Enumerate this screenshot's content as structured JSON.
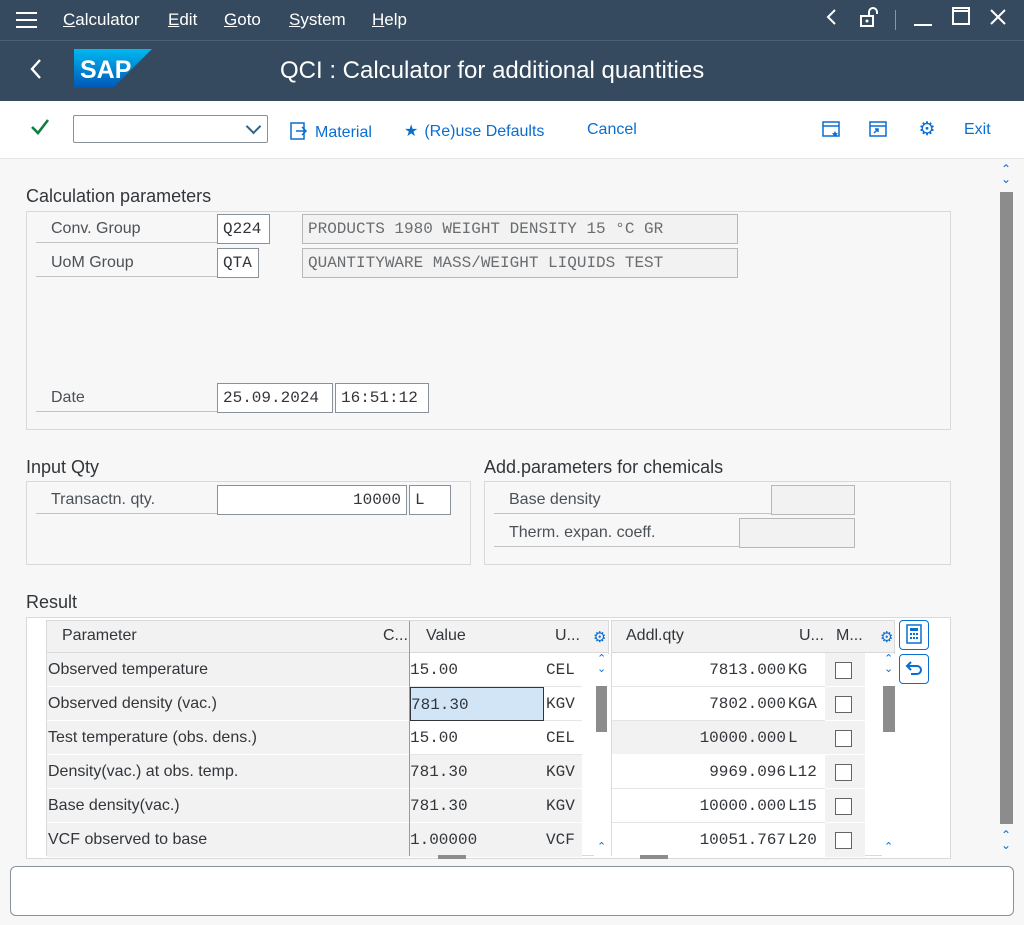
{
  "menu": {
    "items": [
      {
        "u": "C",
        "rest": "alculator"
      },
      {
        "u": "E",
        "rest": "dit"
      },
      {
        "u": "G",
        "rest": "oto"
      },
      {
        "u": "S",
        "rest": "ystem"
      },
      {
        "u": "H",
        "rest": "elp"
      }
    ]
  },
  "header": {
    "title": "QCI : Calculator for additional quantities",
    "logo_text": "SAP"
  },
  "toolbar": {
    "material_label": "Material",
    "reuse_label": "(Re)use Defaults",
    "cancel_label": "Cancel",
    "exit_label": "Exit",
    "combo_value": ""
  },
  "calc_params": {
    "title": "Calculation parameters",
    "conv_group_label": "Conv. Group",
    "conv_group_value": "Q224",
    "conv_group_desc": "PRODUCTS 1980 WEIGHT DENSITY 15 °C GR",
    "uom_group_label": "UoM Group",
    "uom_group_value": "QTA",
    "uom_group_desc": "QUANTITYWARE MASS/WEIGHT LIQUIDS TEST",
    "date_label": "Date",
    "date_value": "25.09.2024",
    "time_value": "16:51:12"
  },
  "input_qty": {
    "title": "Input Qty",
    "transactn_label": "Transactn. qty.",
    "transactn_value": "10000",
    "transactn_unit": "L"
  },
  "chem": {
    "title": "Add.parameters for chemicals",
    "base_density_label": "Base density",
    "therm_label": "Therm. expan. coeff."
  },
  "result": {
    "title": "Result",
    "headers": {
      "parameter": "Parameter",
      "c": "C...",
      "value": "Value",
      "u1": "U...",
      "addl": "Addl.qty",
      "u2": "U...",
      "m": "M..."
    },
    "rows": [
      {
        "parameter": "Observed temperature",
        "value": "15.00",
        "unit": "CEL"
      },
      {
        "parameter": "Observed density (vac.)",
        "value": "781.30",
        "unit": "KGV"
      },
      {
        "parameter": "Test temperature (obs. dens.)",
        "value": "15.00",
        "unit": "CEL"
      },
      {
        "parameter": "Density(vac.) at obs. temp.",
        "value": "781.30",
        "unit": "KGV"
      },
      {
        "parameter": "Base density(vac.)",
        "value": "781.30",
        "unit": "KGV"
      },
      {
        "parameter": "VCF observed to base",
        "value": "1.00000",
        "unit": "VCF"
      }
    ],
    "addl": [
      {
        "qty": "7813.000",
        "unit": "KG"
      },
      {
        "qty": "7802.000",
        "unit": "KGA"
      },
      {
        "qty": "10000.000",
        "unit": "L"
      },
      {
        "qty": "9969.096",
        "unit": "L12"
      },
      {
        "qty": "10000.000",
        "unit": "L15"
      },
      {
        "qty": "10051.767",
        "unit": "L20"
      }
    ]
  },
  "colors": {
    "shell": "#354a5f",
    "accent": "#0a6ed1",
    "ok": "#107e3e"
  },
  "icons": [
    "menu-icon",
    "back-icon",
    "lock-icon",
    "minimize-icon",
    "maximize-icon",
    "close-icon",
    "check-icon",
    "material-icon",
    "star-icon",
    "window-new-icon",
    "window-switch-icon",
    "settings-icon",
    "calculator-icon",
    "undo-icon"
  ]
}
